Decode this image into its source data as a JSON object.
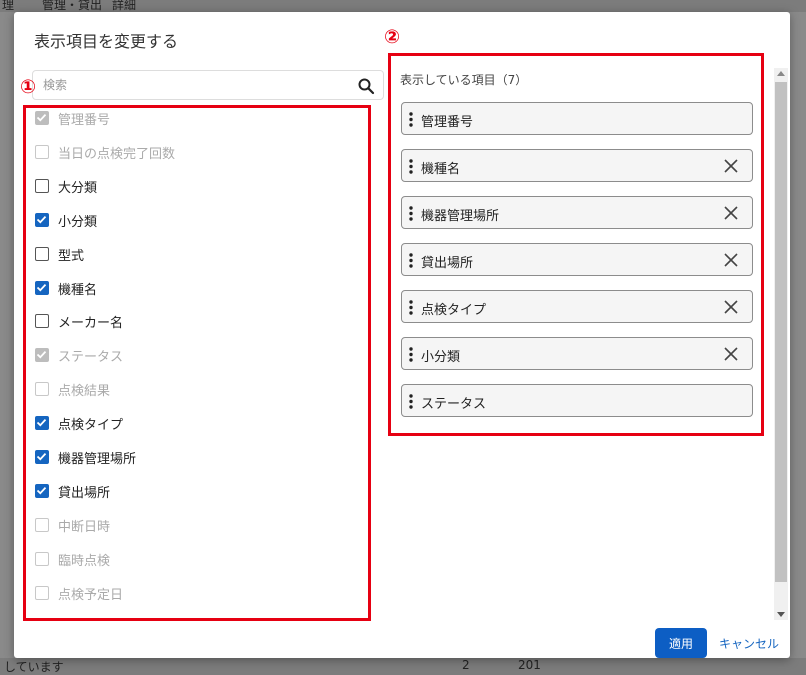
{
  "backdrop": {
    "top_text_1": "理",
    "top_text_2": "管理・貸出",
    "top_text_3": "詳細",
    "bottom_text_1": "しています",
    "bottom_text_2": "2",
    "bottom_text_3": "201"
  },
  "dialog": {
    "title": "表示項目を変更する",
    "search": {
      "placeholder": "検索",
      "value": ""
    },
    "badge_1": "①",
    "badge_2": "②",
    "items": [
      {
        "label": "管理番号",
        "checked": true,
        "disabled": true
      },
      {
        "label": "当日の点検完了回数",
        "checked": false,
        "disabled": true
      },
      {
        "label": "大分類",
        "checked": false,
        "disabled": false
      },
      {
        "label": "小分類",
        "checked": true,
        "disabled": false
      },
      {
        "label": "型式",
        "checked": false,
        "disabled": false
      },
      {
        "label": "機種名",
        "checked": true,
        "disabled": false
      },
      {
        "label": "メーカー名",
        "checked": false,
        "disabled": false
      },
      {
        "label": "ステータス",
        "checked": true,
        "disabled": true
      },
      {
        "label": "点検結果",
        "checked": false,
        "disabled": true
      },
      {
        "label": "点検タイプ",
        "checked": true,
        "disabled": false
      },
      {
        "label": "機器管理場所",
        "checked": true,
        "disabled": false
      },
      {
        "label": "貸出場所",
        "checked": true,
        "disabled": false
      },
      {
        "label": "中断日時",
        "checked": false,
        "disabled": true
      },
      {
        "label": "臨時点検",
        "checked": false,
        "disabled": true
      },
      {
        "label": "点検予定日",
        "checked": false,
        "disabled": true
      }
    ],
    "selected_title": "表示している項目（7）",
    "selected": [
      {
        "label": "管理番号",
        "removable": false
      },
      {
        "label": "機種名",
        "removable": true
      },
      {
        "label": "機器管理場所",
        "removable": true
      },
      {
        "label": "貸出場所",
        "removable": true
      },
      {
        "label": "点検タイプ",
        "removable": true
      },
      {
        "label": "小分類",
        "removable": true
      },
      {
        "label": "ステータス",
        "removable": false
      }
    ],
    "apply_label": "適用",
    "cancel_label": "キャンセル"
  },
  "colors": {
    "accent": "#1565c0",
    "highlight": "#e60012",
    "apply": "#0d5ec4"
  }
}
